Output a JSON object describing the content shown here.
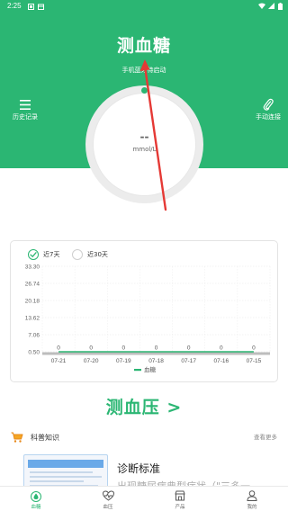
{
  "status_bar": {
    "time": "2:25"
  },
  "header": {
    "title": "测血糖",
    "subtitle": "手机蓝牙待启动",
    "left_button": {
      "label": "历史记录",
      "icon": "menu-icon"
    },
    "right_button": {
      "label": "手动连接",
      "icon": "paperclip-icon"
    }
  },
  "gauge": {
    "value": "--",
    "unit": "mmol/L"
  },
  "chart_card": {
    "range_options": [
      {
        "label": "近7天",
        "selected": true
      },
      {
        "label": "近30天",
        "selected": false
      }
    ]
  },
  "chart_data": {
    "type": "line",
    "x": [
      "07-21",
      "07-20",
      "07-19",
      "07-18",
      "07-17",
      "07-16",
      "07-15"
    ],
    "series": [
      {
        "name": "血糖",
        "values": [
          0,
          0,
          0,
          0,
          0,
          0,
          0
        ],
        "color": "#2bb673"
      }
    ],
    "yticks": [
      "33.30",
      "26.74",
      "20.18",
      "13.62",
      "7.06",
      "0.50"
    ],
    "ylim": [
      0.5,
      33.3
    ],
    "grid": true,
    "legend": "bottom-center"
  },
  "bp_link": {
    "label": "测血压 >"
  },
  "science": {
    "title": "科普知识",
    "more_label": "查看更多",
    "article": {
      "title": "诊断标准",
      "snippet": "出现糖尿病典型症状（\"三多一"
    }
  },
  "tabbar": {
    "tabs": [
      {
        "label": "血糖",
        "icon": "drop-icon",
        "active": true
      },
      {
        "label": "血压",
        "icon": "heart-pulse-icon",
        "active": false
      },
      {
        "label": "产品",
        "icon": "store-icon",
        "active": false
      },
      {
        "label": "我的",
        "icon": "person-icon",
        "active": false
      }
    ]
  },
  "colors": {
    "brand": "#2bb673",
    "pointer": "#e53935"
  }
}
